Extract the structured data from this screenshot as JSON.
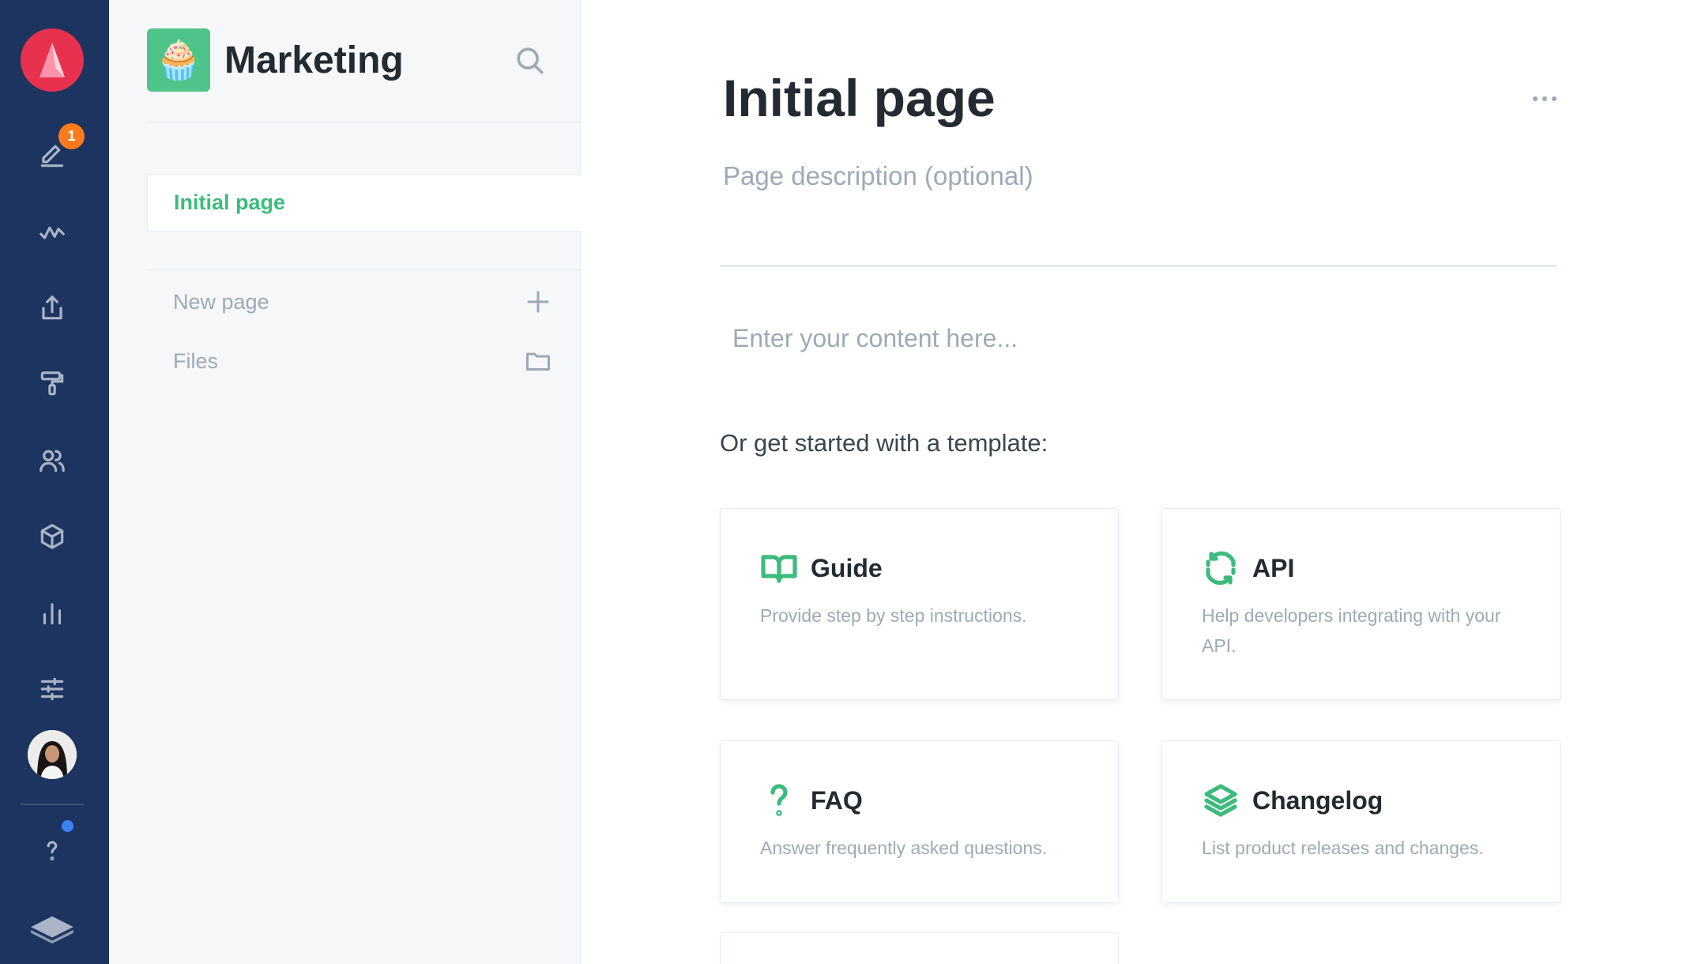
{
  "rail": {
    "edit_badge": "1",
    "icons": [
      "app-logo-icon",
      "edit-icon",
      "activity-icon",
      "share-icon",
      "paint-roller-icon",
      "users-icon",
      "box-icon",
      "analytics-icon",
      "settings-sliders-icon",
      "user-avatar",
      "help-icon",
      "spaces-stack-icon"
    ],
    "colors": {
      "background": "#1d3460",
      "logo": "#e8314e",
      "badge": "#ff7a1a",
      "help_dot": "#3b82f6"
    }
  },
  "sidebar": {
    "space_title": "Marketing",
    "space_emoji": "🧁",
    "active_page": "Initial page",
    "new_page_label": "New page",
    "files_label": "Files",
    "colors": {
      "accent": "#3cbb7d",
      "space_icon_bg": "#4fc48a"
    }
  },
  "main": {
    "page_title": "Initial page",
    "page_description_placeholder": "Page description (optional)",
    "content_placeholder": "Enter your content here...",
    "templates_label": "Or get started with a template:",
    "templates": [
      {
        "icon": "book-icon",
        "title": "Guide",
        "description": "Provide step by step instructions."
      },
      {
        "icon": "refresh-icon",
        "title": "API",
        "description": "Help developers integrating with your API."
      },
      {
        "icon": "question-icon",
        "title": "FAQ",
        "description": "Answer frequently asked questions."
      },
      {
        "icon": "layers-icon",
        "title": "Changelog",
        "description": "List product releases and changes."
      }
    ]
  }
}
